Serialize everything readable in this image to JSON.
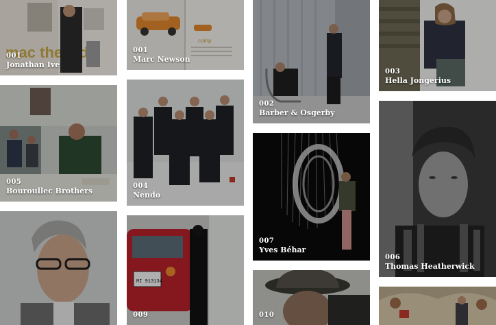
{
  "tiles": [
    {
      "num": "001",
      "name": "Jonathan Ive"
    },
    {
      "num": "001",
      "name": "Marc Newson"
    },
    {
      "num": "002",
      "name": "Barber & Osgerby"
    },
    {
      "num": "003",
      "name": "Hella Jongerius"
    },
    {
      "num": "005",
      "name": "Bouroullec Brothers"
    },
    {
      "num": "004",
      "name": "Nendo"
    },
    {
      "num": "007",
      "name": "Yves Béhar"
    },
    {
      "num": "006",
      "name": "Thomas Heatherwick"
    },
    {
      "num": "",
      "name": ""
    },
    {
      "num": "009",
      "name": ""
    },
    {
      "num": "010",
      "name": ""
    },
    {
      "num": "",
      "name": ""
    }
  ],
  "photo_text": {
    "magazine_headline": "mac the lad",
    "magazine_word": "comp",
    "plate": "MI 913134"
  }
}
